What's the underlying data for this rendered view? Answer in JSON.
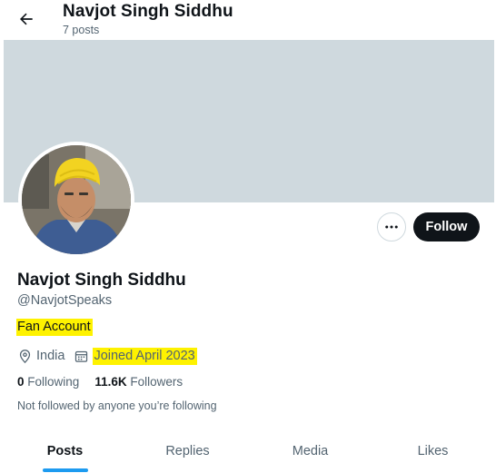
{
  "header": {
    "title": "Navjot Singh Siddhu",
    "post_count": "7 posts"
  },
  "profile": {
    "display_name": "Navjot Singh Siddhu",
    "handle": "@NavjotSpeaks",
    "bio": "Fan Account",
    "location": "India",
    "joined": "Joined April 2023",
    "following_count": "0",
    "following_label": "Following",
    "followers_count": "11.6K",
    "followers_label": "Followers",
    "followed_by_note": "Not followed by anyone you’re following"
  },
  "actions": {
    "follow_label": "Follow",
    "more_icon": "more-horizontal-icon"
  },
  "tabs": [
    {
      "label": "Posts",
      "active": true
    },
    {
      "label": "Replies",
      "active": false
    },
    {
      "label": "Media",
      "active": false
    },
    {
      "label": "Likes",
      "active": false
    }
  ],
  "colors": {
    "banner": "#cfd9de",
    "accent": "#1d9bf0",
    "highlight": "#fef200",
    "follow_button": "#0f1419"
  }
}
